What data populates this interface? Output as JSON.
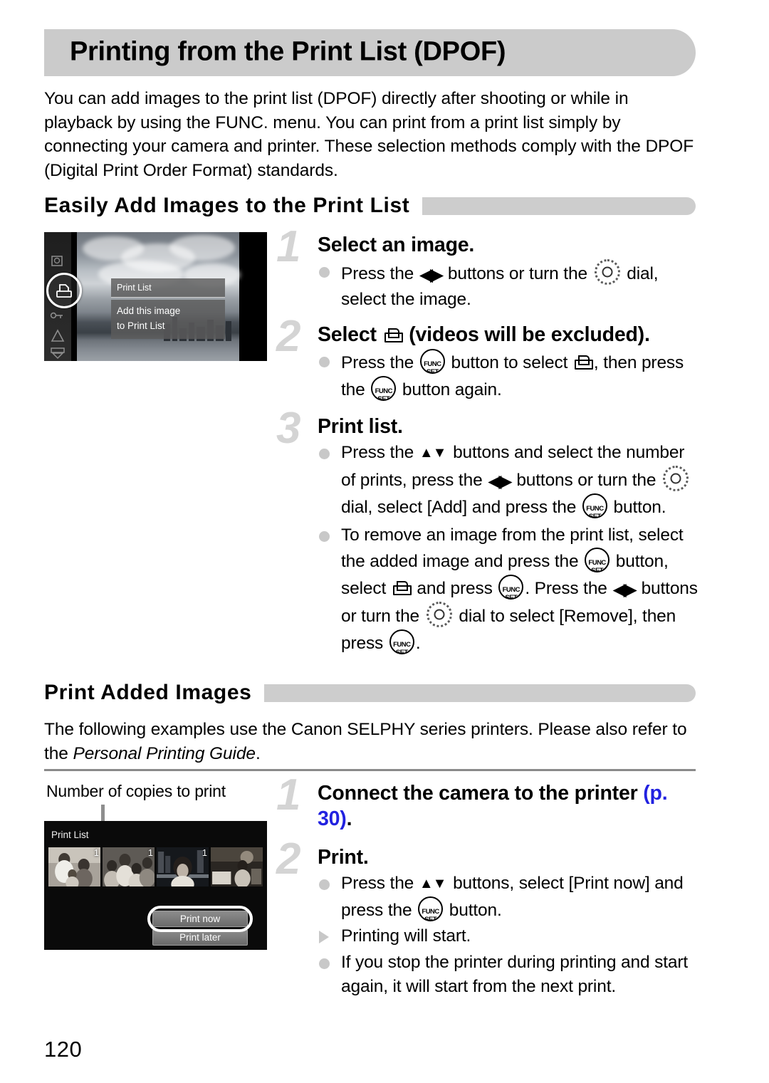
{
  "page": {
    "title": "Printing from the Print List (DPOF)",
    "number": "120",
    "intro": "You can add images to the print list (DPOF) directly after shooting or while in playback by using the FUNC. menu. You can print from a print list simply by connecting your camera and printer. These selection methods comply with the DPOF (Digital Print Order Format) standards."
  },
  "sections": [
    {
      "heading": "Easily Add Images to the Print List"
    },
    {
      "heading": "Print Added Images"
    }
  ],
  "section2_intro": {
    "line1": "The following examples use the Canon SELPHY series printers. Please also",
    "line2_prefix": "refer to the ",
    "line2_italic": "Personal Printing Guide",
    "line2_suffix": "."
  },
  "steps_add": [
    {
      "number": "1",
      "title": "Select an image.",
      "bullets": [
        {
          "marker": "dot",
          "parts": [
            {
              "t": "text",
              "v": "Press the "
            },
            {
              "t": "icon",
              "v": "left-right-buttons-icon"
            },
            {
              "t": "text",
              "v": " buttons or turn the "
            },
            {
              "t": "icon",
              "v": "control-dial-icon"
            },
            {
              "t": "text",
              "v": " dial, select the image."
            }
          ]
        }
      ]
    },
    {
      "number": "2",
      "title_prefix": "Select ",
      "title_icon": "print-icon",
      "title_suffix": " (videos will be excluded).",
      "bullets": [
        {
          "marker": "dot",
          "parts": [
            {
              "t": "text",
              "v": "Press the "
            },
            {
              "t": "icon",
              "v": "func-set-button-icon"
            },
            {
              "t": "text",
              "v": " button to select "
            },
            {
              "t": "icon",
              "v": "print-icon"
            },
            {
              "t": "text",
              "v": ", then press the "
            },
            {
              "t": "icon",
              "v": "func-set-button-icon"
            },
            {
              "t": "text",
              "v": " button again."
            }
          ]
        }
      ]
    },
    {
      "number": "3",
      "title": "Print list.",
      "bullets": [
        {
          "marker": "dot",
          "parts": [
            {
              "t": "text",
              "v": "Press the "
            },
            {
              "t": "icon",
              "v": "up-down-buttons-icon"
            },
            {
              "t": "text",
              "v": " buttons and select the number of prints, press the "
            },
            {
              "t": "icon",
              "v": "left-right-buttons-icon"
            },
            {
              "t": "text",
              "v": " buttons or turn the "
            },
            {
              "t": "icon",
              "v": "control-dial-icon"
            },
            {
              "t": "text",
              "v": " dial, select [Add] and press the "
            },
            {
              "t": "icon",
              "v": "func-set-button-icon"
            },
            {
              "t": "text",
              "v": " button."
            }
          ]
        },
        {
          "marker": "dot",
          "parts": [
            {
              "t": "text",
              "v": "To remove an image from the print list, select the added image and press the "
            },
            {
              "t": "icon",
              "v": "func-set-button-icon"
            },
            {
              "t": "text",
              "v": " button, select "
            },
            {
              "t": "icon",
              "v": "print-icon"
            },
            {
              "t": "text",
              "v": " and press "
            },
            {
              "t": "icon",
              "v": "func-set-button-icon"
            },
            {
              "t": "text",
              "v": ". Press the "
            },
            {
              "t": "icon",
              "v": "left-right-buttons-icon"
            },
            {
              "t": "text",
              "v": " buttons or turn the "
            },
            {
              "t": "icon",
              "v": "control-dial-icon"
            },
            {
              "t": "text",
              "v": " dial to select [Remove], then press "
            },
            {
              "t": "icon",
              "v": "func-set-button-icon"
            },
            {
              "t": "text",
              "v": "."
            }
          ]
        }
      ]
    }
  ],
  "steps_print": [
    {
      "number": "1",
      "title_main": "Connect the camera to the printer",
      "title_link": "(p. 30)",
      "title_tail": ".",
      "link_color": "#2222e0",
      "bullets": []
    },
    {
      "number": "2",
      "title": "Print.",
      "bullets": [
        {
          "marker": "dot",
          "parts": [
            {
              "t": "text",
              "v": "Press the "
            },
            {
              "t": "icon",
              "v": "up-down-buttons-icon"
            },
            {
              "t": "text",
              "v": " buttons, select [Print now] and press the "
            },
            {
              "t": "icon",
              "v": "func-set-button-icon"
            },
            {
              "t": "text",
              "v": " button."
            }
          ]
        },
        {
          "marker": "triangle",
          "parts": [
            {
              "t": "text",
              "v": "Printing will start."
            }
          ]
        },
        {
          "marker": "dot",
          "parts": [
            {
              "t": "text",
              "v": "If you stop the printer during printing and start again, it will start from the next print."
            }
          ]
        }
      ]
    }
  ],
  "camera_screen_func": {
    "menu_title": "Print List",
    "menu_body_line1": "Add this image",
    "menu_body_line2": "to Print List",
    "sidebar_icons": [
      "magnify-icon",
      "print-icon",
      "protect-key-icon",
      "rotate-icon",
      "filter-icon"
    ],
    "selected_icon": "print-icon"
  },
  "callout": {
    "label": "Number of copies to print"
  },
  "camera_screen_printlist": {
    "title": "Print List",
    "thumbnails": [
      {
        "copies": "1"
      },
      {
        "copies": "1"
      },
      {
        "copies": "1"
      },
      {
        "copies": ""
      }
    ],
    "button_print_now": "Print now",
    "button_print_later": "Print later",
    "selected_button": "Print now"
  },
  "colors": {
    "header_bar": "#cbcbcb",
    "section_bar": "#cdcdcd",
    "step_number": "#d4d4d4",
    "bullet_dot": "#c8c8c8",
    "link_blue": "#2222e0",
    "divider": "#8a8a8a"
  }
}
